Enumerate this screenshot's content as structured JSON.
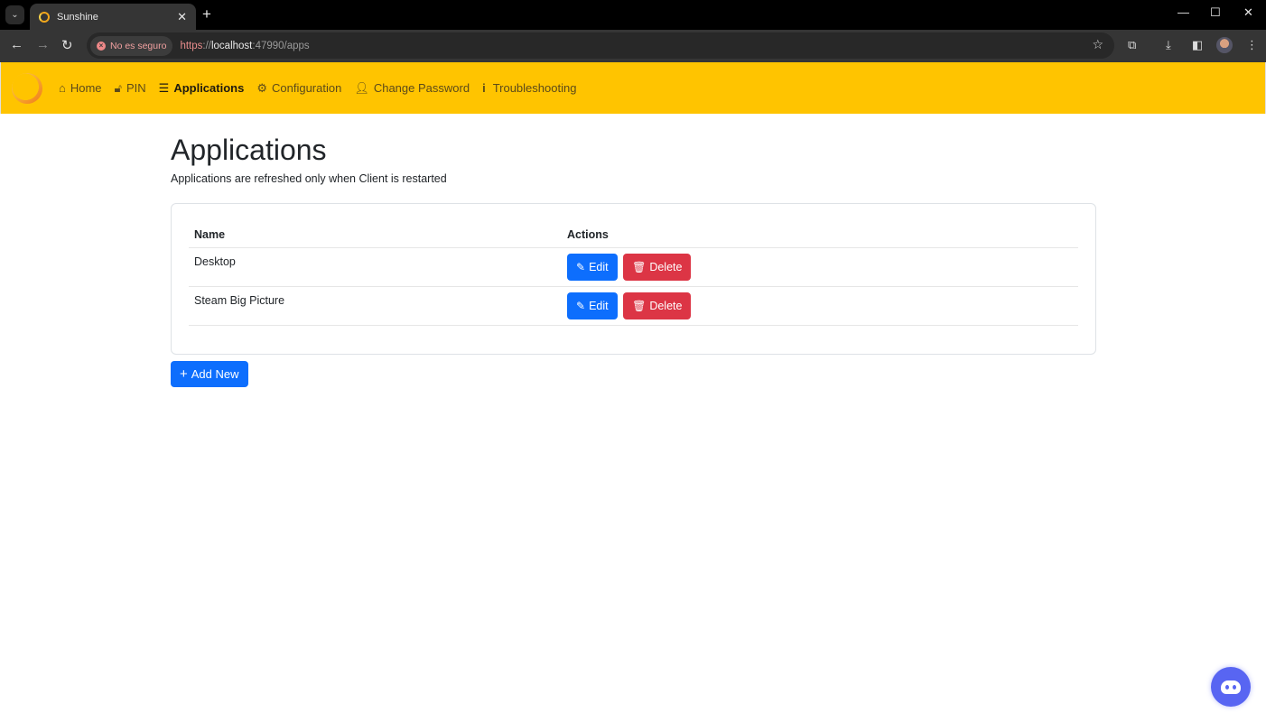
{
  "browser": {
    "tab_title": "Sunshine",
    "new_tab": "+",
    "security_label": "No es seguro",
    "url_scheme": "https",
    "url_sep": "://",
    "url_host": "localhost",
    "url_rest": ":47990/apps"
  },
  "navbar": {
    "items": [
      {
        "label": "Home",
        "icon": "home-icon"
      },
      {
        "label": "PIN",
        "icon": "lock-icon"
      },
      {
        "label": "Applications",
        "icon": "list-icon",
        "active": true
      },
      {
        "label": "Configuration",
        "icon": "gear-icon"
      },
      {
        "label": "Change Password",
        "icon": "user-shield-icon"
      },
      {
        "label": "Troubleshooting",
        "icon": "info-icon"
      }
    ]
  },
  "page": {
    "title": "Applications",
    "subtitle": "Applications are refreshed only when Client is restarted"
  },
  "table": {
    "headers": {
      "name": "Name",
      "actions": "Actions"
    },
    "rows": [
      {
        "name": "Desktop",
        "edit": "Edit",
        "delete": "Delete"
      },
      {
        "name": "Steam Big Picture",
        "edit": "Edit",
        "delete": "Delete"
      }
    ]
  },
  "add_new_label": "Add New",
  "colors": {
    "navbar": "#ffc400",
    "primary": "#0d6efd",
    "danger": "#dc3545",
    "discord": "#5865f2"
  }
}
